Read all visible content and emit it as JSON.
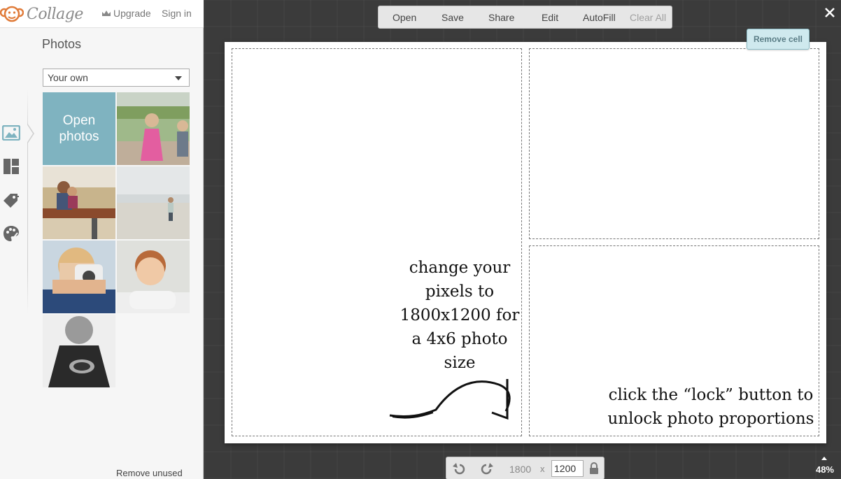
{
  "app": {
    "logo_text": "Collage",
    "upgrade_label": "Upgrade",
    "signin_label": "Sign in"
  },
  "sidebar": {
    "rail_icons": [
      "photos-icon",
      "layouts-icon",
      "stickers-icon",
      "background-icon"
    ],
    "active": "photos-icon",
    "title": "Photos",
    "source_select": "Your own",
    "open_photos_label": "Open photos",
    "remove_unused_label": "Remove unused"
  },
  "toolbar": {
    "open": "Open",
    "save": "Save",
    "share": "Share",
    "edit": "Edit",
    "autofill": "AutoFill",
    "clear_all": "Clear All"
  },
  "canvas": {
    "remove_cell_label": "Remove cell",
    "note_1": "change your pixels to 1800x1200 for a 4x6 photo size",
    "note_2": "click the “lock” button to unlock photo proportions"
  },
  "size_bar": {
    "width": "1800",
    "times": "x",
    "height": "1200"
  },
  "zoom_label": "48%",
  "colors": {
    "accent": "#7fb3c0",
    "remove_cell_bg": "#cfe9ee",
    "logo_orange": "#e07b39"
  }
}
